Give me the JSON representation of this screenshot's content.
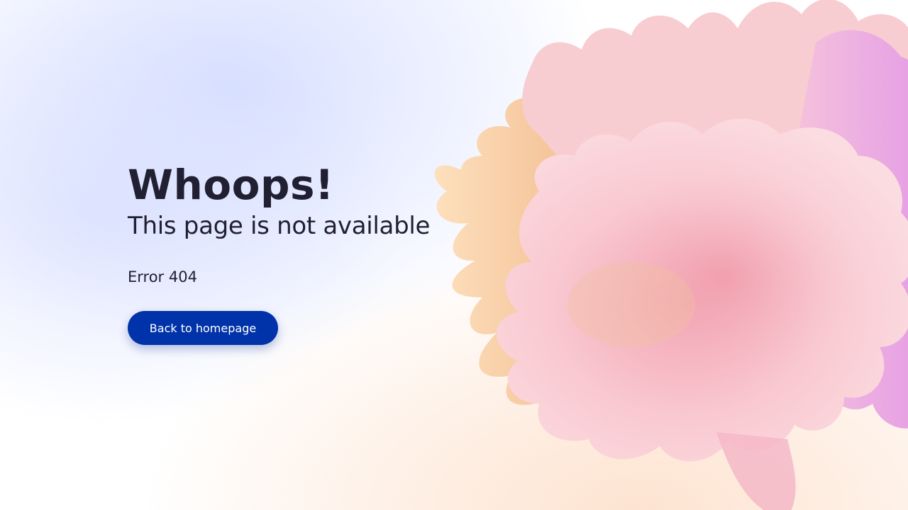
{
  "page": {
    "headline": "Whoops!",
    "subtitle": "This page is not available",
    "error_code": "Error 404",
    "back_button_label": "Back to homepage"
  },
  "colors": {
    "text": "#211f32",
    "button_bg": "#0033a9",
    "button_text": "#ffffff",
    "bg_blue_tint": "#d6deff",
    "bg_peach_tint": "#fde2ce"
  },
  "illustration": {
    "icon": "abstract-3d-blob"
  }
}
